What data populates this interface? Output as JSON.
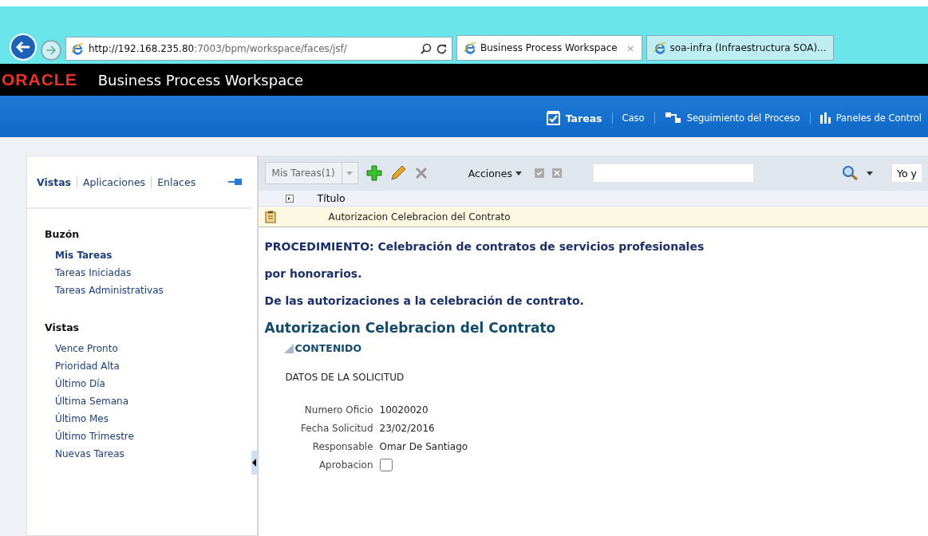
{
  "browser": {
    "address": {
      "host": "http://192.168.235.80",
      "path": ":7003/bpm/workspace/faces/jsf/"
    },
    "tabs": [
      {
        "label": "Business Process Workspace",
        "selected": true,
        "close": "×"
      },
      {
        "label": "soa-infra (Infraestructura SOA)...",
        "selected": false
      }
    ]
  },
  "header": {
    "logo": "ORACLE",
    "title": "Business Process Workspace"
  },
  "nav": [
    {
      "label": "Tareas",
      "kind": "check",
      "selected": true
    },
    {
      "label": "Caso",
      "kind": "plain",
      "selected": false
    },
    {
      "label": "Seguimiento del Proceso",
      "kind": "flow",
      "selected": false
    },
    {
      "label": "Paneles de Control",
      "kind": "bars",
      "selected": false
    }
  ],
  "sidebar": {
    "tabs": [
      {
        "label": "Vistas",
        "selected": true
      },
      {
        "label": "Aplicaciones",
        "selected": false
      },
      {
        "label": "Enlaces",
        "selected": false
      }
    ],
    "sections": [
      {
        "title": "Buzón",
        "items": [
          {
            "label": "Mis Tareas",
            "selected": true
          },
          {
            "label": "Tareas Iniciadas",
            "selected": false
          },
          {
            "label": "Tareas Administrativas",
            "selected": false
          }
        ]
      },
      {
        "title": "Vistas",
        "items": [
          {
            "label": "Vence Pronto",
            "selected": false
          },
          {
            "label": "Prioridad Alta",
            "selected": false
          },
          {
            "label": "Último Día",
            "selected": false
          },
          {
            "label": "Última Semana",
            "selected": false
          },
          {
            "label": "Último Mes",
            "selected": false
          },
          {
            "label": "Último Trimestre",
            "selected": false
          },
          {
            "label": "Nuevas Tareas",
            "selected": false
          }
        ]
      }
    ]
  },
  "toolbar": {
    "view": "Mis Tareas(1)",
    "actions": "Acciones",
    "filter": "Yo y"
  },
  "table": {
    "columns": [
      "Título"
    ],
    "rows": [
      {
        "title": "Autorizacion Celebracion del Contrato",
        "selected": true
      }
    ]
  },
  "detail": {
    "procedure": [
      "PROCEDIMIENTO: Celebración de contratos de servicios profesionales",
      "por honorarios.",
      "De las autorizaciones a la celebración de contrato."
    ],
    "title": "Autorizacion Celebracion del Contrato",
    "section": {
      "title": "CONTENIDO",
      "expanded": true,
      "subtitle": "DATOS DE LA SOLICITUD",
      "fields": [
        {
          "kind": "text",
          "label": "Numero Oficio",
          "value": "10020020"
        },
        {
          "kind": "text",
          "label": "Fecha Solicitud",
          "value": "23/02/2016"
        },
        {
          "kind": "text",
          "label": "Responsable",
          "value": "Omar De Santiago"
        },
        {
          "kind": "checkbox",
          "label": "Aprobacion",
          "checked": false
        }
      ]
    }
  }
}
